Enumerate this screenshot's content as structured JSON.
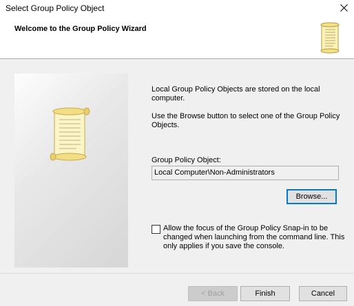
{
  "window": {
    "title": "Select Group Policy Object"
  },
  "header": {
    "heading": "Welcome to the Group Policy Wizard"
  },
  "body": {
    "intro_text": "Local Group Policy Objects are stored on the local computer.",
    "browse_text": "Use the Browse button to select one of the Group Policy Objects.",
    "gpo_label": "Group Policy Object:",
    "gpo_value": "Local Computer\\Non-Administrators",
    "browse_label": "Browse...",
    "checkbox_checked": false,
    "checkbox_label": "Allow the focus of the Group Policy Snap-in to be changed when launching from the command line. This only applies if you save the console."
  },
  "footer": {
    "back_label": "< Back",
    "finish_label": "Finish",
    "cancel_label": "Cancel"
  },
  "icons": {
    "close": "close-icon",
    "header_scroll": "scroll-icon",
    "panel_scroll": "scroll-icon"
  }
}
